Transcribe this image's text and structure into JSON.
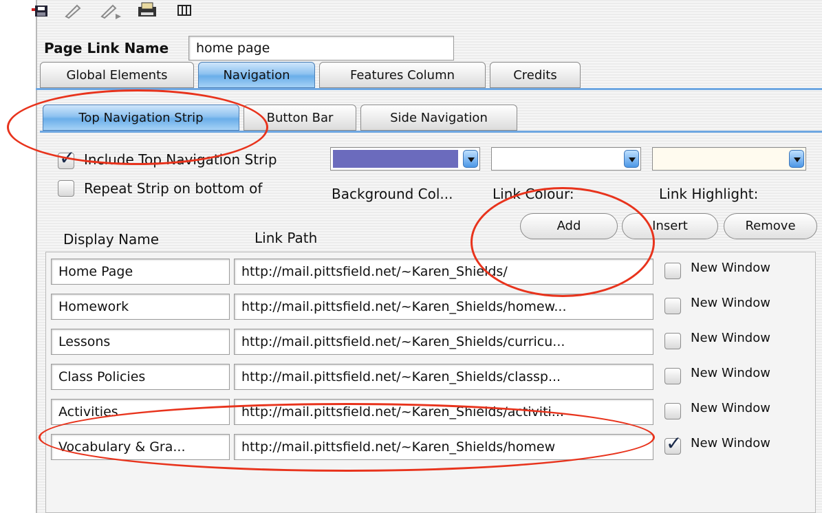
{
  "toolbar": {
    "icons": [
      "save-icon",
      "edit-pencil-icon",
      "pencil-arrow-icon",
      "printer-icon",
      "columns-icon"
    ]
  },
  "page_link": {
    "label": "Page Link Name",
    "value": "home page"
  },
  "main_tabs": [
    {
      "label": "Global Elements",
      "selected": false
    },
    {
      "label": "Navigation",
      "selected": true
    },
    {
      "label": "Features Column",
      "selected": false
    },
    {
      "label": "Credits",
      "selected": false
    }
  ],
  "sub_tabs": [
    {
      "label": "Top Navigation Strip",
      "selected": true
    },
    {
      "label": "Button Bar",
      "selected": false
    },
    {
      "label": "Side Navigation",
      "selected": false
    }
  ],
  "options": {
    "include_label": "Include Top Navigation Strip",
    "include_checked": true,
    "repeat_label": "Repeat Strip on bottom of",
    "repeat_checked": false
  },
  "colors": {
    "background_label": "Background Col...",
    "background_value": "#6b6bbd",
    "link_label": "Link Colour:",
    "link_value": "#ffffff",
    "highlight_label": "Link Highlight:",
    "highlight_value": "#fffbef"
  },
  "buttons": {
    "add": "Add",
    "insert": "Insert",
    "remove": "Remove"
  },
  "table": {
    "col_display": "Display Name",
    "col_path": "Link Path",
    "rows": [
      {
        "name": "Home Page",
        "path": "http://mail.pittsfield.net/~Karen_Shields/",
        "new_window_label": "New Window",
        "new_window": false
      },
      {
        "name": "Homework",
        "path": "http://mail.pittsfield.net/~Karen_Shields/homew...",
        "new_window_label": "New Window",
        "new_window": false
      },
      {
        "name": "Lessons",
        "path": "http://mail.pittsfield.net/~Karen_Shields/curricu...",
        "new_window_label": "New Window",
        "new_window": false
      },
      {
        "name": "Class Policies",
        "path": "http://mail.pittsfield.net/~Karen_Shields/classp...",
        "new_window_label": "New Window",
        "new_window": false
      },
      {
        "name": "Activities",
        "path": "http://mail.pittsfield.net/~Karen_Shields/activiti...",
        "new_window_label": "New Window",
        "new_window": false
      },
      {
        "name": "Vocabulary & Gra...",
        "path": "http://mail.pittsfield.net/~Karen_Shields/homew",
        "new_window_label": "New Window",
        "new_window": true
      }
    ]
  },
  "annotation_color": "#e8331c"
}
